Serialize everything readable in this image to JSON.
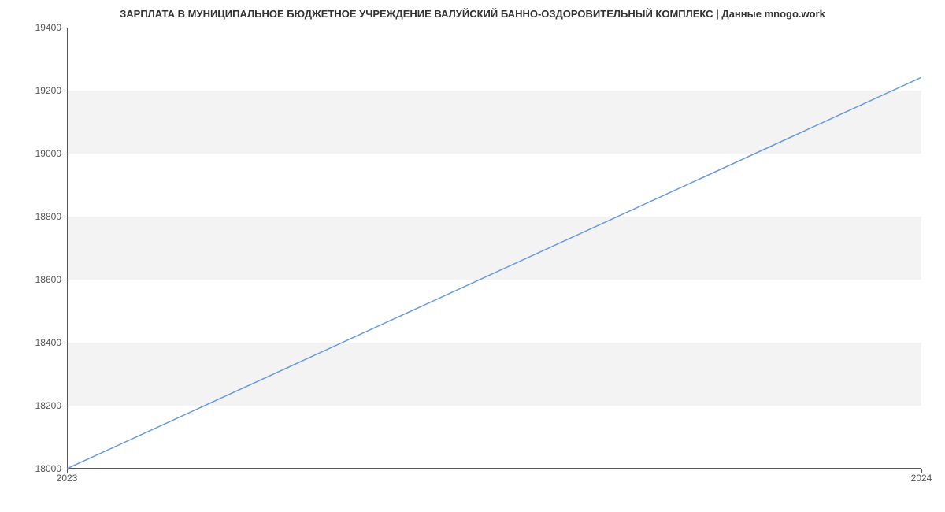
{
  "chart_data": {
    "type": "line",
    "title": "ЗАРПЛАТА В МУНИЦИПАЛЬНОЕ БЮДЖЕТНОЕ УЧРЕЖДЕНИЕ ВАЛУЙСКИЙ БАННО-ОЗДОРОВИТЕЛЬНЫЙ КОМПЛЕКС | Данные mnogo.work",
    "x": [
      2023,
      2024
    ],
    "values": [
      18000,
      19242
    ],
    "xlabel": "",
    "ylabel": "",
    "ylim": [
      18000,
      19400
    ],
    "y_ticks": [
      18000,
      18200,
      18400,
      18600,
      18800,
      19000,
      19200,
      19400
    ],
    "x_ticks": [
      2023,
      2024
    ],
    "line_color": "#6a9ae0",
    "band_color": "#f3f3f3"
  }
}
